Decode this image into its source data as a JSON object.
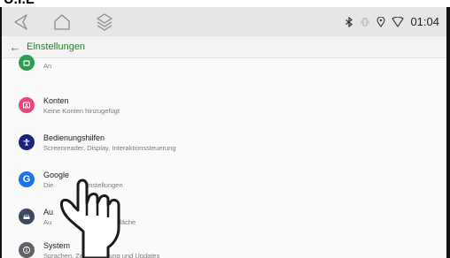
{
  "caption": "U.I.L",
  "statusbar": {
    "time": "01:04",
    "icons": [
      "bluetooth-icon",
      "vibrate-icon",
      "location-icon",
      "wifi-icon"
    ]
  },
  "navbar": {
    "icons": [
      "back-icon",
      "home-icon",
      "recent-apps-icon"
    ]
  },
  "appbar": {
    "back_icon": "arrow-back-icon",
    "title": "Einstellungen"
  },
  "settings": {
    "items": [
      {
        "title": "",
        "subtitle": "An",
        "icon": "security-icon",
        "color": "#2e9d4f"
      },
      {
        "title": "Konten",
        "subtitle": "Keine Konten hinzugefügt",
        "icon": "accounts-icon",
        "color": "#e8467c"
      },
      {
        "title": "Bedienungshilfen",
        "subtitle": "Screenreader, Display, Interaktionssteuerung",
        "icon": "accessibility-icon",
        "color": "#1a237e"
      },
      {
        "title": "Google",
        "subtitle": "Die                Einstellungen",
        "icon": "google-icon",
        "color": "#1a73e8"
      },
      {
        "title": "Au                     en",
        "subtitle": "Au                            Oberfläche",
        "icon": "car-icon",
        "color": "#3c4a5e"
      },
      {
        "title": "System",
        "subtitle": "Sprachen, Zeit, Sicherung und Updates",
        "icon": "info-icon",
        "color": "#5f6368"
      }
    ]
  },
  "colors": {
    "accent": "#2e7d32",
    "navbar_bg": "#e6e6e6",
    "list_bg": "#fafafa"
  }
}
